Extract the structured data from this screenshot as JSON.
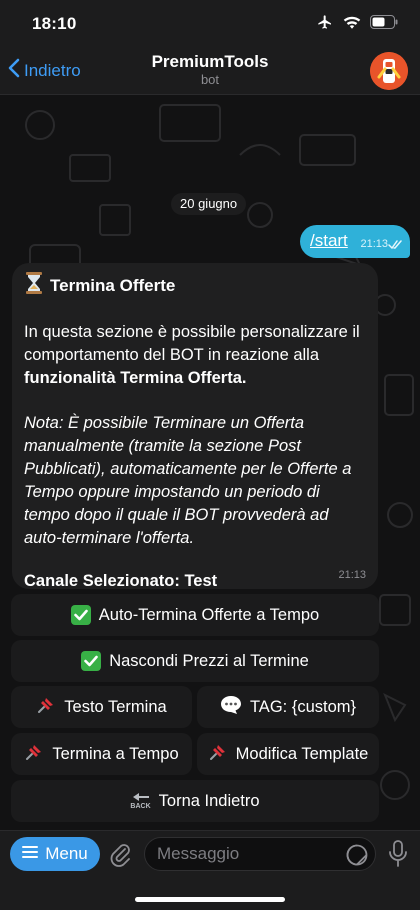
{
  "status_bar": {
    "time": "18:10",
    "icons": [
      "airplane-icon",
      "wifi-icon",
      "battery-icon"
    ]
  },
  "nav": {
    "back_label": "Indietro",
    "title": "PremiumTools",
    "subtitle": "bot"
  },
  "chat": {
    "date_chip": "20 giugno",
    "outgoing": {
      "text": "/start",
      "time": "21:13",
      "status": "read"
    },
    "incoming": {
      "title_icon": "hourglass-icon",
      "title": "Termina Offerte",
      "intro": "In questa sezione è possibile personalizzare il comportamento del BOT in reazione alla",
      "intro_bold": "funzionalità Termina Offerta.",
      "note": "Nota: È possibile Terminare un Offerta manualmente (tramite la sezione Post Pubblicati), automaticamente per le Offerte a Tempo oppure impostando un periodo di tempo dopo il quale il BOT provvederà ad auto-terminare l'offerta.",
      "channel": "Canale Selezionato: Test",
      "time": "21:13"
    }
  },
  "keyboard": {
    "auto_termina": {
      "icon": "check-mark-icon",
      "label": "Auto-Termina Offerte a Tempo"
    },
    "nascondi_prezzi": {
      "icon": "check-mark-icon",
      "label": "Nascondi Prezzi al Termine"
    },
    "testo_termina": {
      "icon": "pushpin-icon",
      "label": "Testo Termina"
    },
    "tag": {
      "icon": "speech-bubble-icon",
      "label": "TAG: {custom}"
    },
    "termina_tempo": {
      "icon": "pushpin-icon",
      "label": "Termina a Tempo"
    },
    "modifica_template": {
      "icon": "pushpin-icon",
      "label": "Modifica Template"
    },
    "torna_indietro": {
      "icon": "back-arrow-icon",
      "icon_text": "BACK",
      "label": "Torna Indietro"
    }
  },
  "input_bar": {
    "menu_label": "Menu",
    "placeholder": "Messaggio"
  },
  "colors": {
    "accent": "#3e9cf5",
    "outgoing_bubble": "#2fb1d9",
    "incoming_bubble": "#1f1f20",
    "menu_button": "#3a98e6",
    "check_green": "#38b046"
  }
}
